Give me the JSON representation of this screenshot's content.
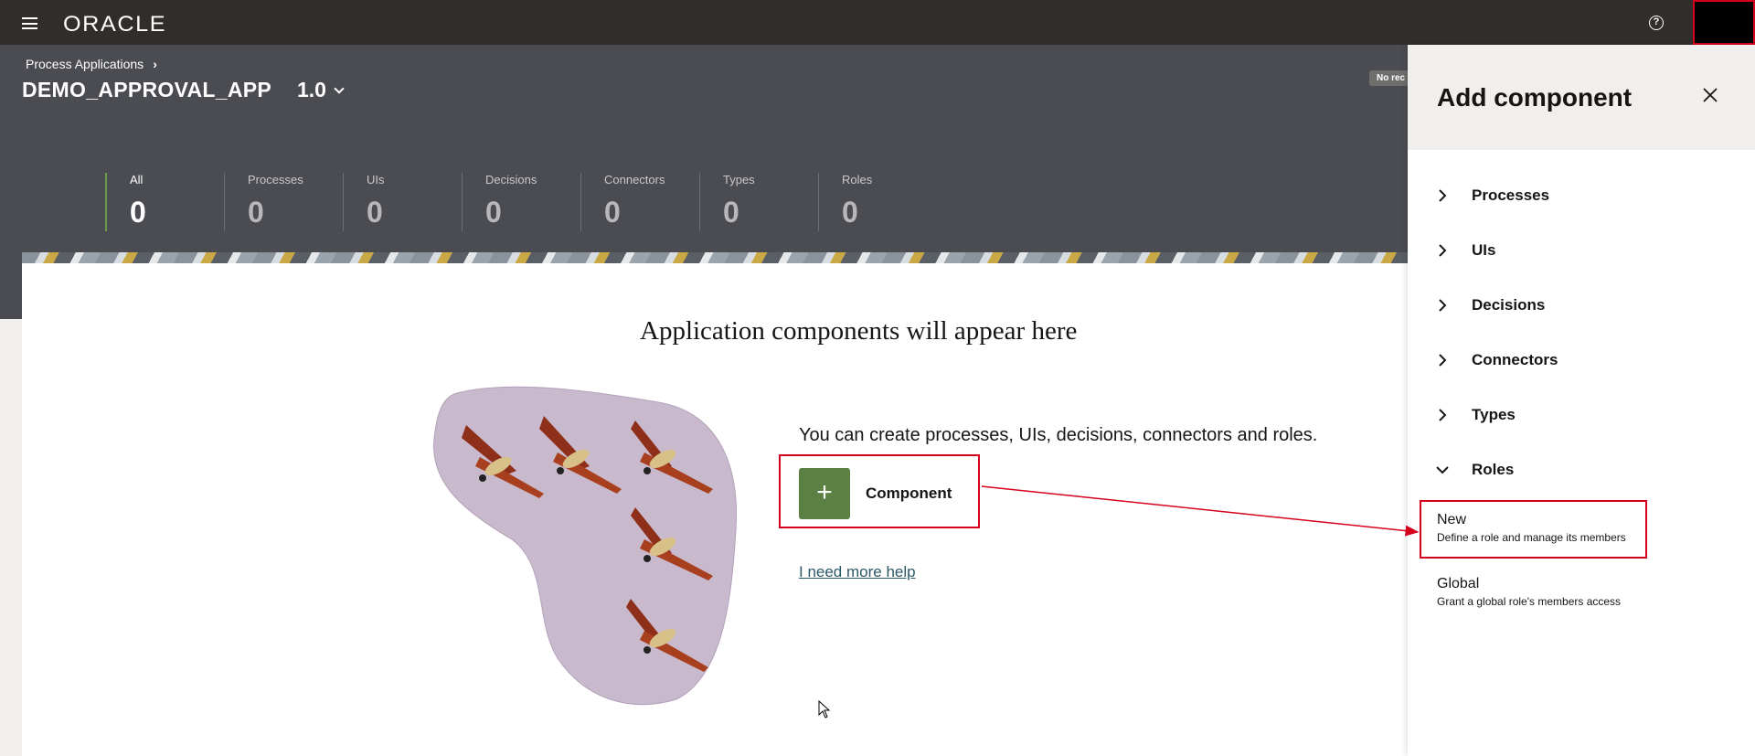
{
  "topbar": {
    "logo": "ORACLE",
    "help_icon": "help-circle-icon",
    "menu_icon": "hamburger-menu-icon"
  },
  "header": {
    "breadcrumb": "Process Applications",
    "app_title": "DEMO_APPROVAL_APP",
    "version": "1.0",
    "badge": "No rec"
  },
  "stats": [
    {
      "label": "All",
      "value": "0"
    },
    {
      "label": "Processes",
      "value": "0"
    },
    {
      "label": "UIs",
      "value": "0"
    },
    {
      "label": "Decisions",
      "value": "0"
    },
    {
      "label": "Connectors",
      "value": "0"
    },
    {
      "label": "Types",
      "value": "0"
    },
    {
      "label": "Roles",
      "value": "0"
    }
  ],
  "main": {
    "empty_title": "Application components will appear here",
    "empty_desc": "You can create processes, UIs, decisions, connectors and roles.",
    "component_label": "Component",
    "help_link": "I need more help"
  },
  "drawer": {
    "title": "Add component",
    "sections": [
      {
        "label": "Processes"
      },
      {
        "label": "UIs"
      },
      {
        "label": "Decisions"
      },
      {
        "label": "Connectors"
      },
      {
        "label": "Types"
      },
      {
        "label": "Roles"
      }
    ],
    "roles_items": [
      {
        "title": "New",
        "desc": "Define a role and manage its members"
      },
      {
        "title": "Global",
        "desc": "Grant a global role's members access"
      }
    ]
  },
  "colors": {
    "topbar": "#312d2a",
    "header": "#4a4c52",
    "accent_green": "#5b8043",
    "highlight_red": "#d6001c"
  }
}
